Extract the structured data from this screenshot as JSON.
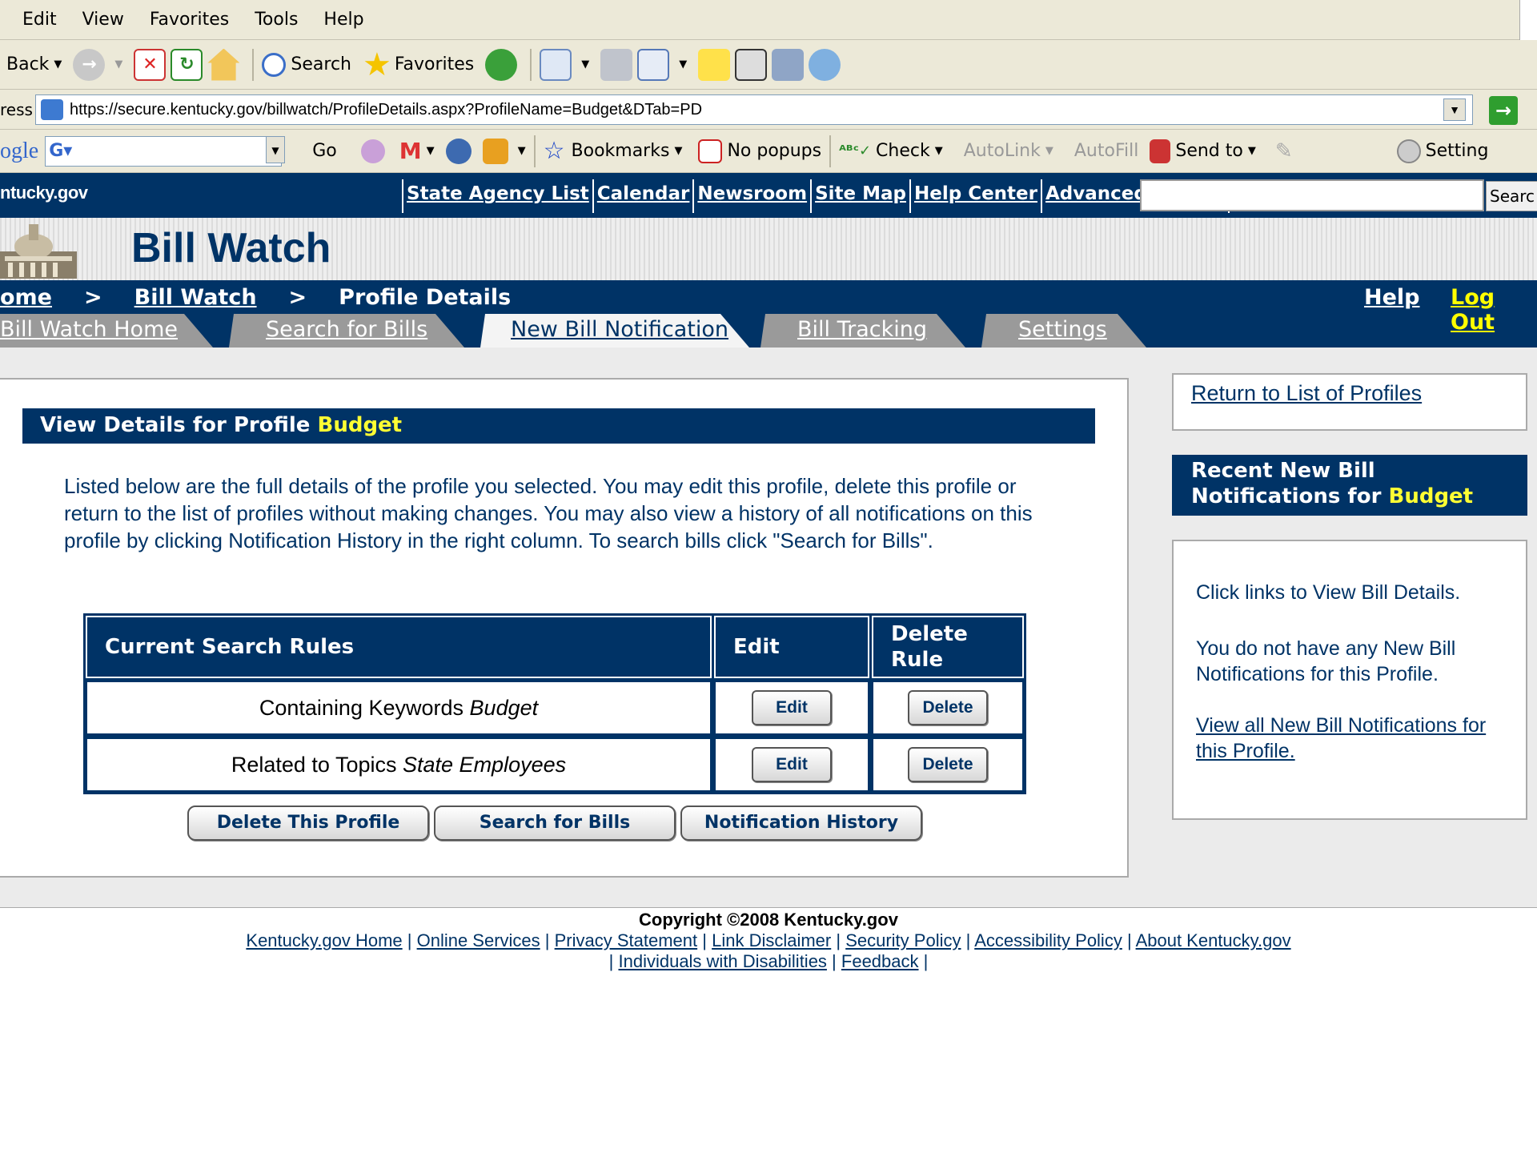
{
  "browser": {
    "menu": [
      "Edit",
      "View",
      "Favorites",
      "Tools",
      "Help"
    ],
    "toolbar": {
      "back": "Back",
      "search": "Search",
      "favorites": "Favorites"
    },
    "address_label": "ress",
    "url": "https://secure.kentucky.gov/billwatch/ProfileDetails.aspx?ProfileName=Budget&DTab=PD",
    "googlebar": {
      "logo": "ogle",
      "go": "Go",
      "bookmarks": "Bookmarks",
      "popups": "No popups",
      "check": "Check",
      "autolink": "AutoLink",
      "autofill": "AutoFill",
      "sendto": "Send to",
      "settings": "Setting"
    }
  },
  "site": {
    "logo": "ntucky.gov",
    "links": [
      "State Agency List",
      "Calendar",
      "Newsroom",
      "Site Map",
      "Help Center",
      "Advanced Search"
    ],
    "search_button": "Searc",
    "app_title": "Bill Watch"
  },
  "nav": {
    "crumbs": {
      "home": "ome",
      "sep1": ">",
      "billwatch": "Bill Watch",
      "sep2": ">",
      "current": "Profile Details"
    },
    "help": "Help",
    "logout": "Log Out",
    "tabs": [
      "Bill Watch Home",
      "Search for Bills",
      "New Bill Notification",
      "Bill Tracking",
      "Settings"
    ],
    "active_tab": "New Bill Notification"
  },
  "main": {
    "heading_prefix": "View Details for Profile",
    "profile_name": "Budget",
    "intro": "Listed below are the full details of the profile you selected. You may edit this profile, delete this profile or return to the list of profiles without making changes. You may also view a history of all notifications on this profile by clicking Notification History in the right column. To search bills click \"Search for Bills\".",
    "table": {
      "headers": [
        "Current Search Rules",
        "Edit",
        "Delete Rule"
      ],
      "rows": [
        {
          "prefix": "Containing Keywords",
          "value": "Budget",
          "edit": "Edit",
          "delete": "Delete"
        },
        {
          "prefix": "Related to Topics",
          "value": "State Employees",
          "edit": "Edit",
          "delete": "Delete"
        }
      ]
    },
    "buttons": {
      "delete_profile": "Delete This Profile",
      "search": "Search for Bills",
      "history": "Notification History"
    }
  },
  "sidebar": {
    "return_link": "Return to List of Profiles",
    "recent_heading_prefix": "Recent New Bill Notifications for",
    "recent_profile": "Budget",
    "instructions": "Click links to View Bill Details.",
    "empty_message": "You do not have any New Bill Notifications for this Profile.",
    "view_all": "View all New Bill Notifications for this Profile."
  },
  "footer": {
    "copyright": "Copyright ©2008 Kentucky.gov",
    "links_row1": [
      "Kentucky.gov Home",
      "Online Services",
      "Privacy Statement",
      "Link Disclaimer",
      "Security Policy",
      "Accessibility Policy",
      "About Kentucky.gov"
    ],
    "links_row2": [
      "Individuals with Disabilities",
      "Feedback"
    ]
  },
  "colors": {
    "brand_navy": "#003366",
    "highlight_yellow": "#ffff33",
    "tab_gray": "#9a9a9a"
  }
}
